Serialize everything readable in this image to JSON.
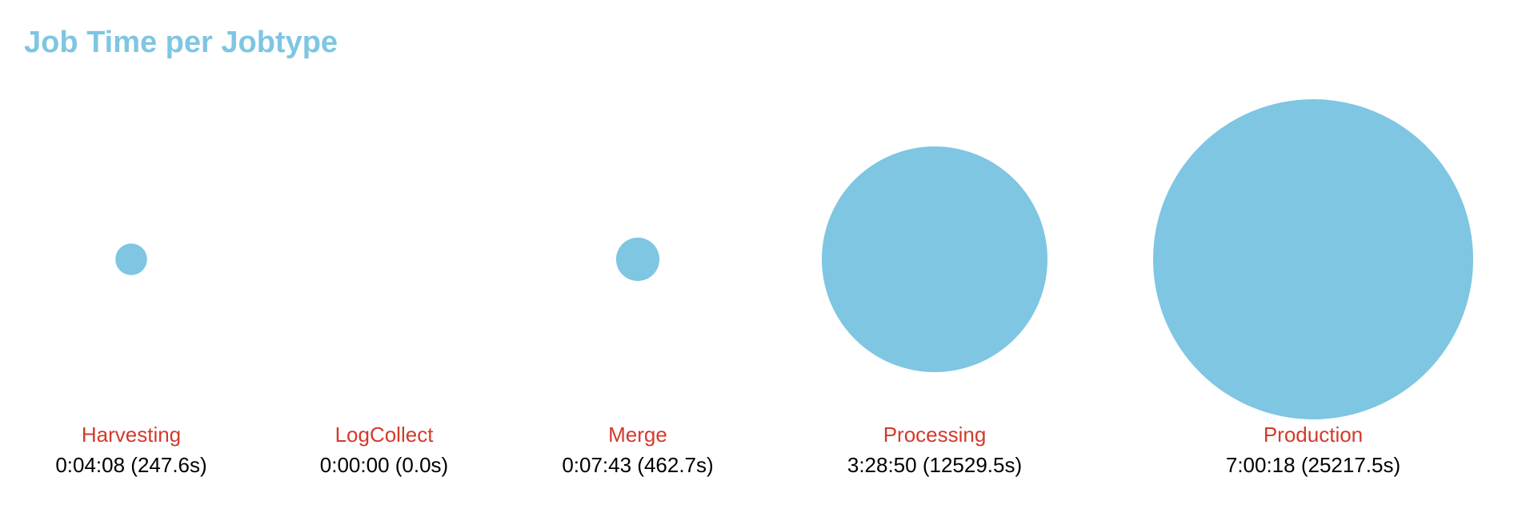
{
  "title": "Job Time per Jobtype",
  "colors": {
    "title": "#7ec6e2",
    "bubble": "#7ec6e2",
    "label": "#d33a2c",
    "value": "#000000"
  },
  "chart_data": {
    "type": "bubble",
    "title": "Job Time per Jobtype",
    "xlabel": "",
    "ylabel": "",
    "grid": false,
    "legend": "none",
    "categories": [
      "Harvesting",
      "LogCollect",
      "Merge",
      "Processing",
      "Production"
    ],
    "values": [
      247.6,
      0.0,
      462.7,
      12529.5,
      25217.5
    ],
    "value_labels": [
      "0:04:08 (247.6s)",
      "0:00:00 (0.0s)",
      "0:07:43 (462.7s)",
      "3:28:50 (12529.5s)",
      "7:00:18 (25217.5s)"
    ]
  }
}
